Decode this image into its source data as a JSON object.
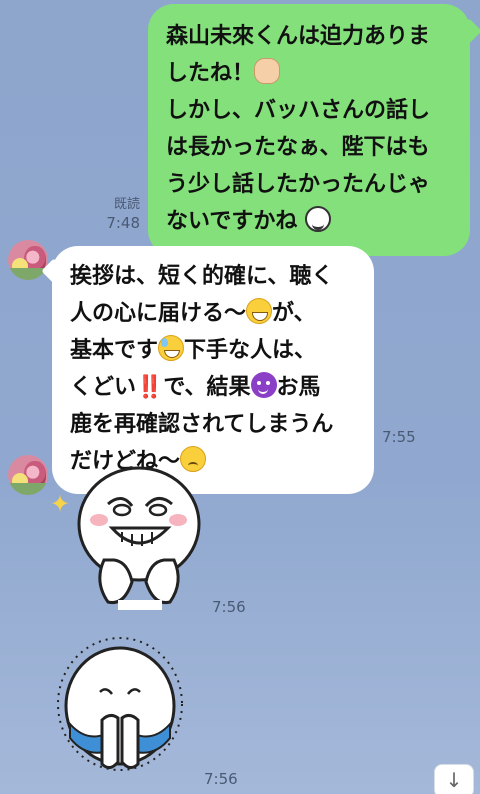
{
  "messages": {
    "outgoing": {
      "lines": [
        "森山未來くんは迫力ありま",
        "したね！",
        "しかし、バッハさんの話し",
        "は長かったなぁ、陛下はも",
        "う少し話したかったんじゃ",
        "ないですかね"
      ],
      "read_label": "既読",
      "time": "7:48",
      "emoji": [
        "clap-emoji",
        "squint-laugh-emoji"
      ]
    },
    "incoming": {
      "line1": "挨拶は、短く的確に、聴く",
      "line2a": "人の心に届ける〜",
      "line2b": "が、",
      "line3a": "基本です",
      "line3b": "下手な人は、",
      "line4a": "くどい",
      "line4bang": "‼️",
      "line4b": "で、結果",
      "line4c": "お馬",
      "line5": "鹿を再確認されてしまうん",
      "line6": "だけどね〜",
      "time": "7:55",
      "emoji": [
        "grin-emoji",
        "sweat-smile-emoji",
        "double-exclamation",
        "devil-emoji",
        "confounded-emoji"
      ]
    },
    "sticker1": {
      "time": "7:56",
      "type": "grinning-character-sticker"
    },
    "sticker2": {
      "time": "7:56",
      "type": "crying-character-sticker"
    }
  },
  "colors": {
    "background": "#8ea6cc",
    "outgoing_bubble": "#84e07b",
    "incoming_bubble": "#ffffff",
    "meta_text": "#4a5a74"
  },
  "controls": {
    "scroll_down_icon": "↓"
  }
}
